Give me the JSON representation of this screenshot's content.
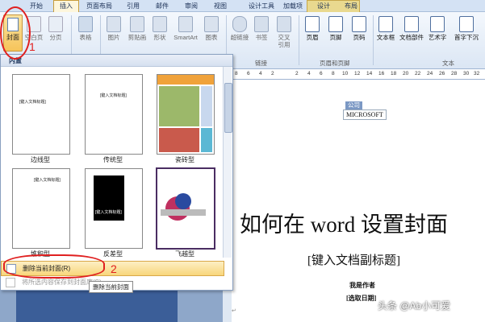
{
  "tabs": [
    "开始",
    "插入",
    "页面布局",
    "引用",
    "邮件",
    "审阅",
    "视图",
    "设计工具",
    "加载项",
    "设计",
    "布局"
  ],
  "ribbon": {
    "cover_label": "封面",
    "blank_label": "空白页",
    "pagebreak_label": "分页",
    "table_label": "表格",
    "picture_label": "图片",
    "clipart_label": "剪贴画",
    "shapes_label": "形状",
    "smartart_label": "SmartArt",
    "chart_label": "图表",
    "hyperlink_label": "超链接",
    "bookmark_label": "书签",
    "crossref_label": "交叉引用",
    "header_label": "页眉",
    "footer_label": "页脚",
    "pagenum_label": "页码",
    "textbox_label": "文本框",
    "quickparts_label": "文档部件",
    "wordart_label": "艺术字",
    "dropcap_label": "首字下沉",
    "group_links": "链接",
    "group_headerfooter": "页眉和页脚",
    "group_text": "文本"
  },
  "gallery": {
    "header": "内置",
    "items": [
      "边线型",
      "传统型",
      "瓷砖型",
      "堆积型",
      "反差型",
      "飞越型"
    ],
    "thumb_title": "[键入文档标题]",
    "remove_label": "删除当前封面(R)",
    "save_label": "将所选内容保存到封面库(S)...",
    "tooltip": "删除当前封面"
  },
  "ruler": [
    "8",
    "6",
    "4",
    "2",
    "",
    "2",
    "4",
    "6",
    "8",
    "10",
    "12",
    "14",
    "16",
    "18",
    "20",
    "22",
    "24",
    "26",
    "28",
    "30",
    "32"
  ],
  "document": {
    "company_tag": "公司",
    "company": "MICROSOFT",
    "title": "如何在 word 设置封面",
    "subtitle": "[键入文档副标题]",
    "author": "我是作者",
    "date": "[选取日期]"
  },
  "annotations": [
    "1",
    "2"
  ],
  "watermark": "头条 @Ab小可爱",
  "colors": {
    "accent": "#f6c45a",
    "annotation": "#e02020",
    "ribbon": "#dbe6f4"
  }
}
